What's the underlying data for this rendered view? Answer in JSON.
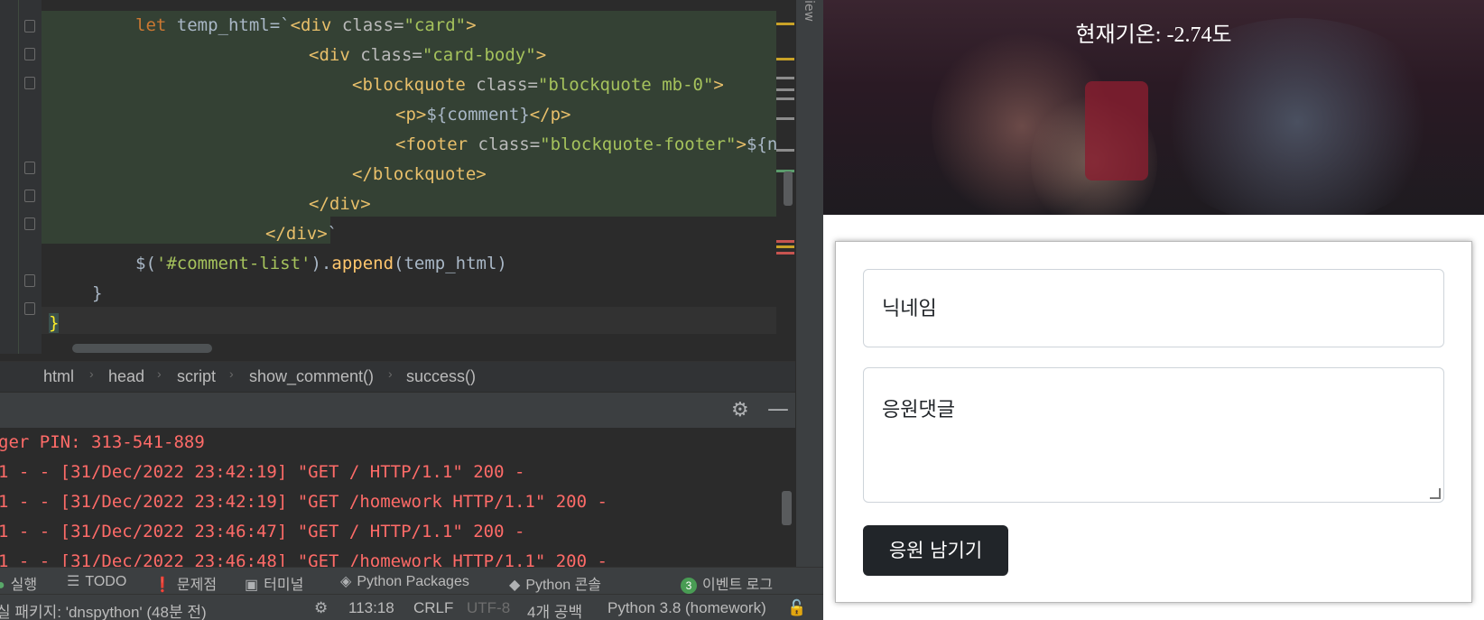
{
  "editor": {
    "code_lines": [
      "let temp_html=`<div class=\"card\">",
      "<div class=\"card-body\">",
      "<blockquote class=\"blockquote mb-0\">",
      "<p>${comment}</p>",
      "<footer class=\"blockquote-footer\">${n",
      "</blockquote>",
      "</div>",
      "</div>`",
      "$('#comment-list').append(temp_html)",
      "}",
      "}"
    ],
    "side_tab": "iew"
  },
  "breadcrumbs": [
    "html",
    "head",
    "script",
    "show_comment()",
    "success()"
  ],
  "run_panel": {
    "gear_icon": "gear-icon",
    "minimize_icon": "minimize-icon"
  },
  "console_lines": [
    "ger PIN: 313-541-889",
    "1 - - [31/Dec/2022 23:42:19] \"GET / HTTP/1.1\" 200 -",
    "1 - - [31/Dec/2022 23:42:19] \"GET /homework HTTP/1.1\" 200 -",
    "1 - - [31/Dec/2022 23:46:47] \"GET / HTTP/1.1\" 200 -",
    "1 - - [31/Dec/2022 23:46:48] \"GET /homework HTTP/1.1\" 200 -"
  ],
  "tool_tabs": {
    "run": "실행",
    "todo": "TODO",
    "problems": "문제점",
    "terminal": "터미널",
    "python_packages": "Python Packages",
    "python_console": "Python 콘솔",
    "event_log_count": "3",
    "event_log": "이벤트 로그"
  },
  "status_bar": {
    "message": "실 패키지: 'dnspython' (48분 전)",
    "position": "113:18",
    "line_sep": "CRLF",
    "encoding": "UTF-8",
    "indent": "4개 공백",
    "interpreter": "Python 3.8 (homework)"
  },
  "web": {
    "temperature": "현재기온: -2.74도",
    "nickname_placeholder": "닉네임",
    "comment_placeholder": "응원댓글",
    "submit_label": "응원 남기기"
  }
}
